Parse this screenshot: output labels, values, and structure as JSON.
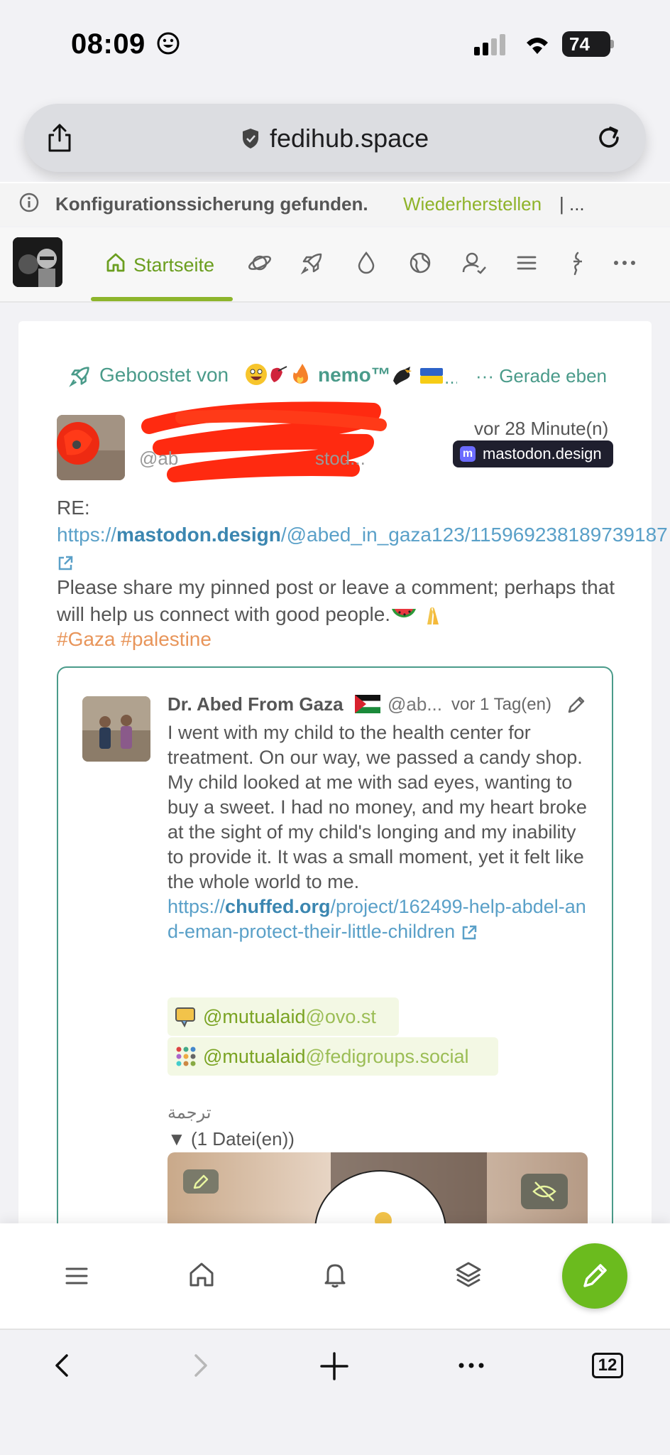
{
  "status_bar": {
    "time": "08:09",
    "battery": "74"
  },
  "browser": {
    "url": "fedihub.space",
    "tabs_count": "12"
  },
  "notification": {
    "text": "Konfigurationssicherung gefunden.",
    "action": "Wiederherstellen",
    "more": "| ..."
  },
  "nav": {
    "home_label": "Startseite",
    "items": [
      "home-icon",
      "planet-icon",
      "rocket-icon",
      "drop-icon",
      "globe-icon",
      "user-check-icon",
      "list-icon",
      "feather-icon",
      "more-icon"
    ]
  },
  "post": {
    "boost_label": "Geboostet von",
    "booster_name": "nemo™",
    "boost_time": "··· Gerade eben",
    "author_handle_start": "@ab",
    "author_handle_end": "stod...",
    "post_time": "vor 28 Minute(n)",
    "server": "mastodon.design",
    "re_prefix": "RE: ",
    "re_link_scheme": "https://",
    "re_link_domain": "mastodon.design",
    "re_link_path": "/@abed_in_gaza123/115969238189739187",
    "body": "Please share my pinned post or leave a comment; perhaps that will help us connect with good people.",
    "hashtags": "#Gaza #palestine"
  },
  "quote": {
    "author": "Dr. Abed From Gaza",
    "handle": "@ab...",
    "time": "vor 1 Tag(en)",
    "text": "I went with my child to the health center for treatment. On our way, we passed a candy shop. My child looked at me with sad eyes, wanting to buy a sweet. I had no money, and my heart broke at the sight of my child's longing and my inability to provide it. It was a small moment, yet it felt like the whole world to me.",
    "link_scheme": "https://",
    "link_domain": "chuffed.org",
    "link_path": "/project/162499-help-abdel-and-eman-protect-their-little-children",
    "mention1_user": "@mutualaid",
    "mention1_domain": "@ovo.st",
    "mention2_user": "@mutualaid",
    "mention2_domain": "@fedigroups.social",
    "translate_label": "ترجمة",
    "files_label": "▼ (1 Datei(en))"
  },
  "colors": {
    "accent": "#6b9e1f",
    "teal": "#4a9b8a",
    "compose": "#6bbb1e",
    "link": "#3b86b0",
    "hashtag": "#e8955a"
  }
}
